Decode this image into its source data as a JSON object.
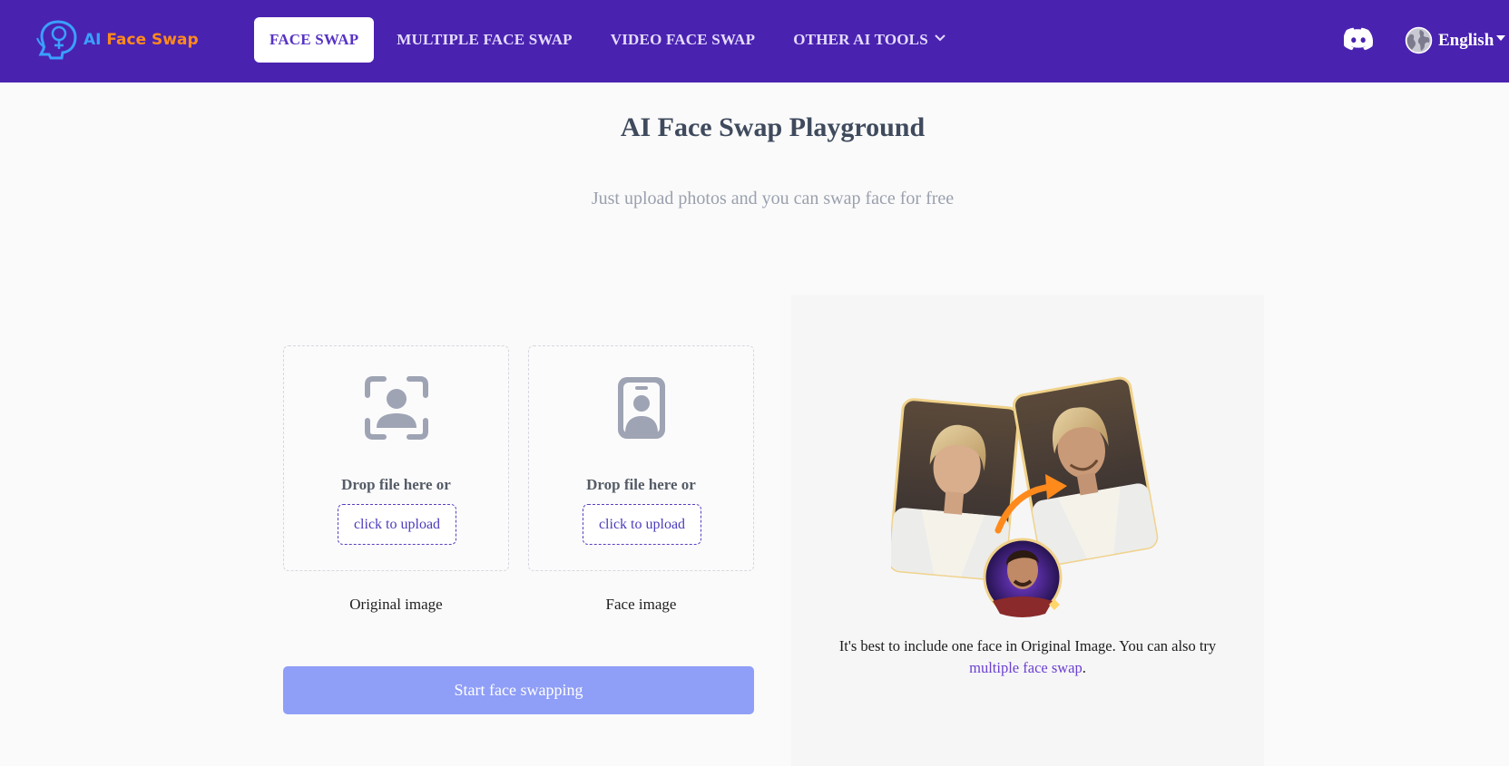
{
  "brand": {
    "name_part1": "AI",
    "name_part2": "Face Swap"
  },
  "nav": {
    "items": [
      {
        "label": "FACE SWAP",
        "active": true
      },
      {
        "label": "MULTIPLE FACE SWAP",
        "active": false
      },
      {
        "label": "VIDEO FACE SWAP",
        "active": false
      },
      {
        "label": "OTHER AI TOOLS",
        "active": false,
        "has_dropdown": true
      }
    ],
    "discord_icon": "discord-icon",
    "language": "English"
  },
  "hero": {
    "title": "AI Face Swap Playground",
    "subtitle": "Just upload photos and you can swap face for free"
  },
  "uploads": [
    {
      "drop_text": "Drop file here or",
      "button_label": "click to upload",
      "caption": "Original image",
      "icon": "face-scan-icon"
    },
    {
      "drop_text": "Drop file here or",
      "button_label": "click to upload",
      "caption": "Face image",
      "icon": "id-badge-icon"
    }
  ],
  "start_button": "Start face swapping",
  "example": {
    "note": "It's best to include one face in Original Image. You can also try",
    "link_text": "multiple face swap",
    "link_suffix": "."
  },
  "colors": {
    "header_bg": "#4a22b0",
    "accent": "#5733c4",
    "start_button_bg": "#8f9ef7",
    "logo_blue": "#3aa0ff",
    "logo_orange": "#ff8a1c"
  }
}
